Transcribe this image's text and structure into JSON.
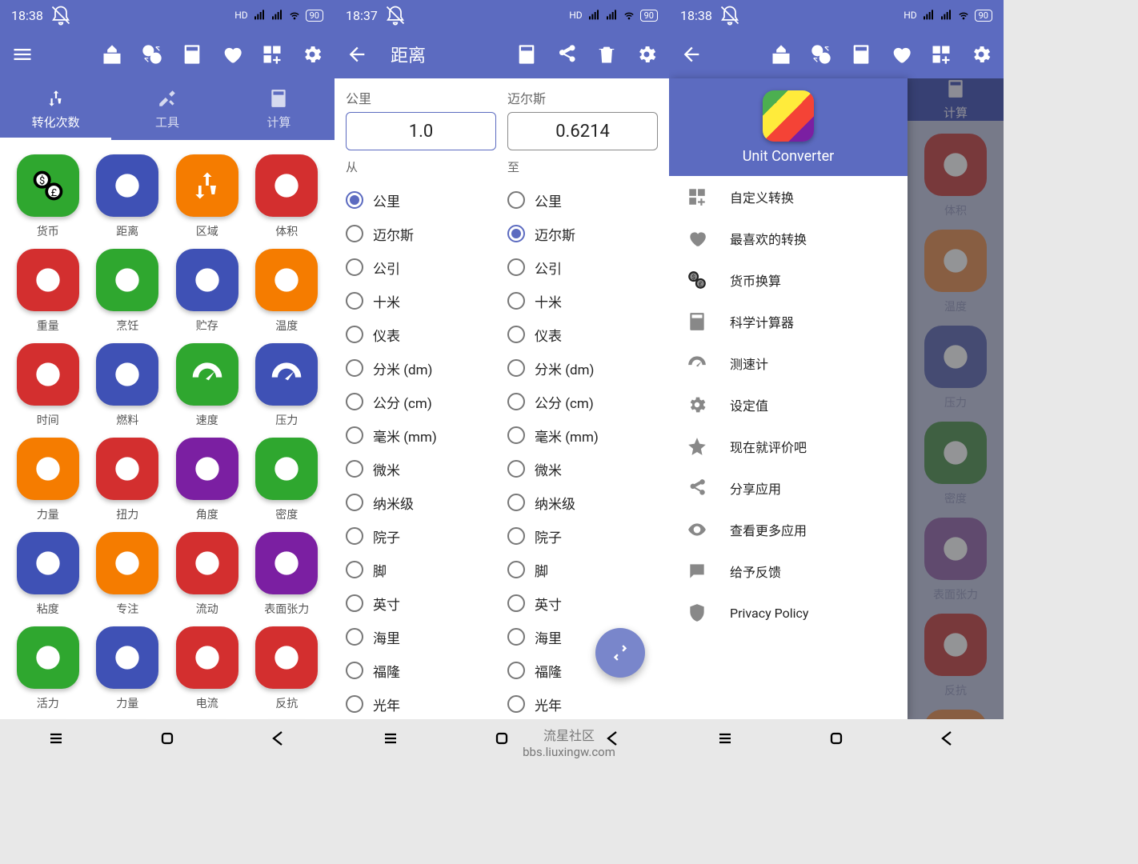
{
  "status": {
    "time1": "18:38",
    "time2": "18:37",
    "time3": "18:38",
    "battery": "90",
    "hd": "HD"
  },
  "toolbar": {
    "icons": [
      "menu",
      "mosque",
      "currency",
      "calculator",
      "favorite",
      "widgets",
      "settings"
    ],
    "back": "back",
    "share": "share",
    "delete": "delete"
  },
  "tabs": {
    "t1": "转化次数",
    "t2": "工具",
    "t3": "计算"
  },
  "categories": [
    {
      "label": "货币",
      "color": "#2fa72f"
    },
    {
      "label": "距离",
      "color": "#3f51b5"
    },
    {
      "label": "区域",
      "color": "#f57c00"
    },
    {
      "label": "体积",
      "color": "#d32f2f"
    },
    {
      "label": "重量",
      "color": "#d32f2f"
    },
    {
      "label": "烹饪",
      "color": "#2fa72f"
    },
    {
      "label": "贮存",
      "color": "#3f51b5"
    },
    {
      "label": "温度",
      "color": "#f57c00"
    },
    {
      "label": "时间",
      "color": "#d32f2f"
    },
    {
      "label": "燃料",
      "color": "#3f51b5"
    },
    {
      "label": "速度",
      "color": "#2fa72f"
    },
    {
      "label": "压力",
      "color": "#3f51b5"
    },
    {
      "label": "力量",
      "color": "#f57c00"
    },
    {
      "label": "扭力",
      "color": "#d32f2f"
    },
    {
      "label": "角度",
      "color": "#7b1fa2"
    },
    {
      "label": "密度",
      "color": "#2fa72f"
    },
    {
      "label": "粘度",
      "color": "#3f51b5"
    },
    {
      "label": "专注",
      "color": "#f57c00"
    },
    {
      "label": "流动",
      "color": "#d32f2f"
    },
    {
      "label": "表面张力",
      "color": "#7b1fa2"
    },
    {
      "label": "活力",
      "color": "#2fa72f"
    },
    {
      "label": "力量",
      "color": "#3f51b5"
    },
    {
      "label": "电流",
      "color": "#d32f2f"
    },
    {
      "label": "反抗",
      "color": "#d32f2f"
    },
    {
      "label": "",
      "color": "#3f51b5"
    },
    {
      "label": "",
      "color": "#2fa72f"
    },
    {
      "label": "",
      "color": "#3f51b5"
    },
    {
      "label": "",
      "color": "#f57c00"
    }
  ],
  "conversion": {
    "title": "距离",
    "fromLabelTop": "公里",
    "toLabelTop": "迈尔斯",
    "fromValue": "1.0",
    "toValue": "0.6214",
    "fromHeader": "从",
    "toHeader": "至",
    "units": [
      "公里",
      "迈尔斯",
      "公引",
      "十米",
      "仪表",
      "分米 (dm)",
      "公分 (cm)",
      "毫米 (mm)",
      "微米",
      "纳米级",
      "院子",
      "脚",
      "英寸",
      "海里",
      "福隆",
      "光年"
    ],
    "fromSelected": "公里",
    "toSelected": "迈尔斯"
  },
  "drawer": {
    "appName": "Unit Converter",
    "items": [
      {
        "icon": "widgets",
        "label": "自定义转换"
      },
      {
        "icon": "favorite",
        "label": "最喜欢的转换"
      },
      {
        "icon": "currency",
        "label": "货币换算"
      },
      {
        "icon": "calculator",
        "label": "科学计算器"
      },
      {
        "icon": "gauge",
        "label": "测速计"
      },
      {
        "icon": "settings",
        "label": "设定值"
      },
      {
        "icon": "star",
        "label": "现在就评价吧"
      },
      {
        "icon": "share",
        "label": "分享应用"
      },
      {
        "icon": "eye",
        "label": "查看更多应用"
      },
      {
        "icon": "feedback",
        "label": "给予反馈"
      },
      {
        "icon": "shield",
        "label": "Privacy Policy"
      }
    ]
  },
  "bgCats": [
    {
      "label": "体积",
      "color": "#c94d4d"
    },
    {
      "label": "温度",
      "color": "#e8955a"
    },
    {
      "label": "压力",
      "color": "#6670b8"
    },
    {
      "label": "密度",
      "color": "#5a9a5a"
    },
    {
      "label": "表面张力",
      "color": "#9a6fb0"
    },
    {
      "label": "反抗",
      "color": "#c94d4d"
    },
    {
      "label": "",
      "color": "#e8955a"
    }
  ],
  "watermark": {
    "l1": "流星社区",
    "l2": "bbs.liuxingw.com"
  }
}
